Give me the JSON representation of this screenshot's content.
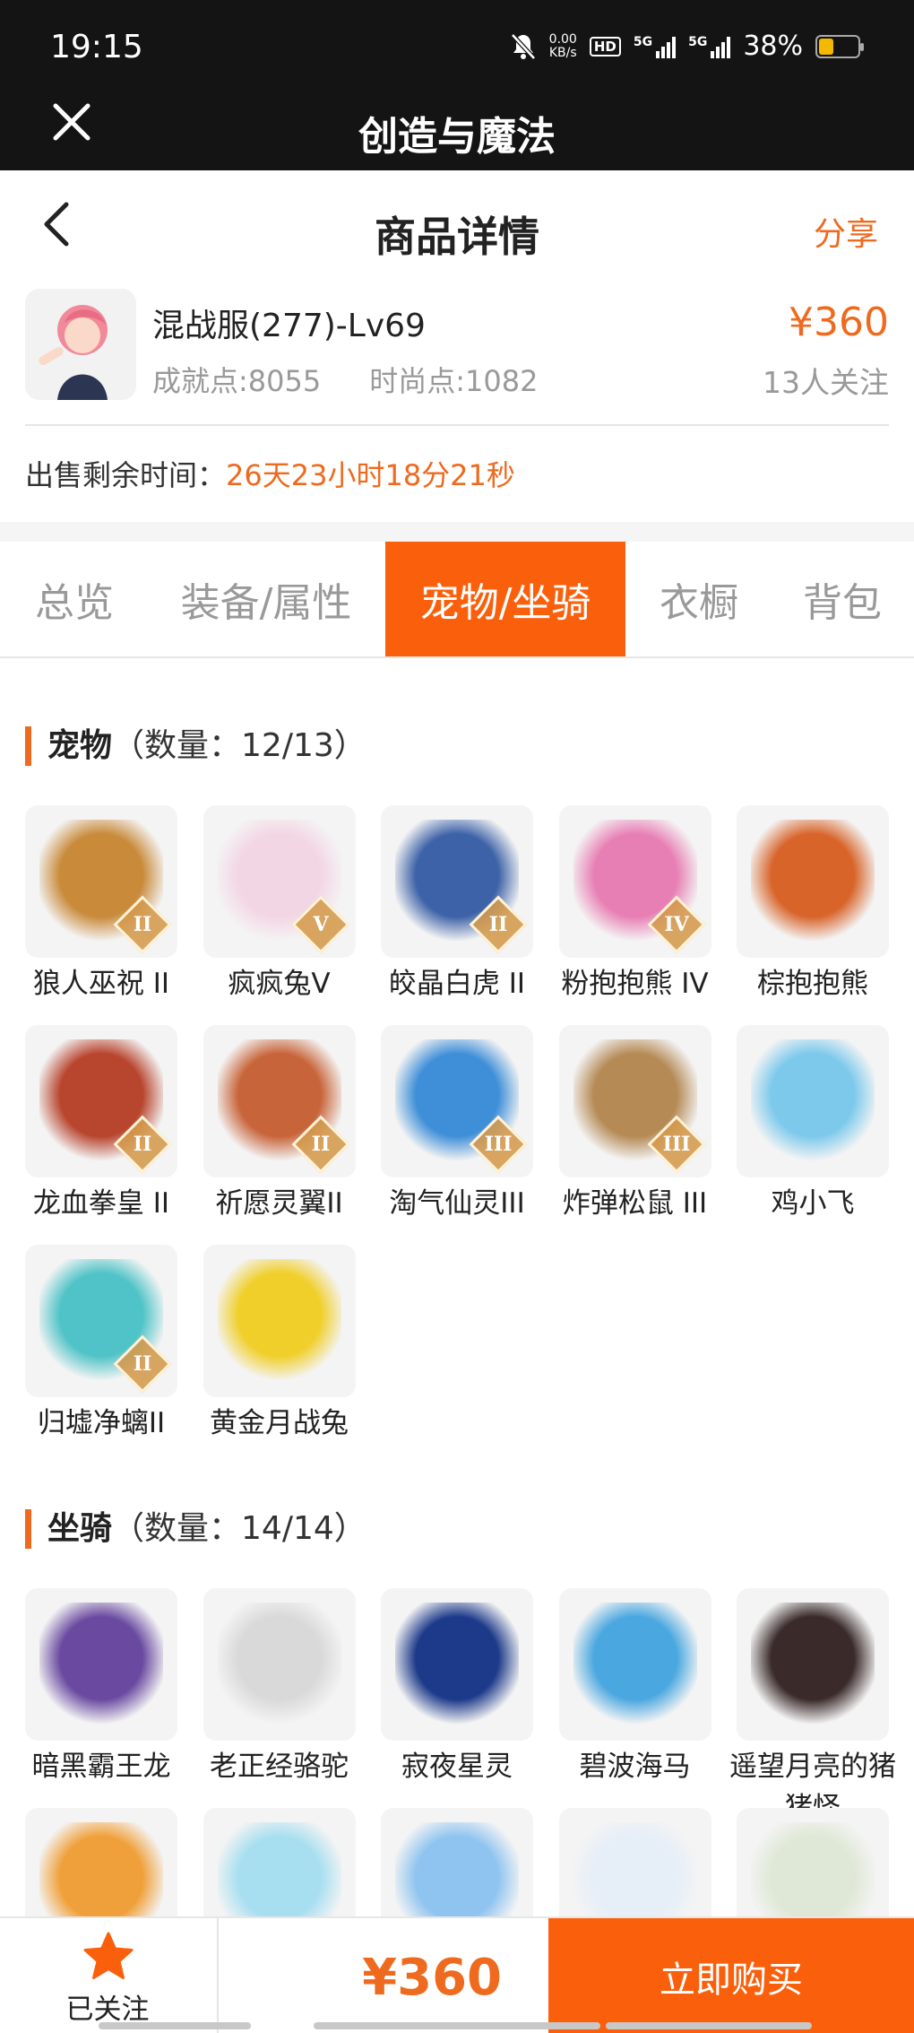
{
  "status_bar": {
    "time": "19:15",
    "net_speed_top": "0.00",
    "net_speed_unit": "KB/s",
    "hd_label": "HD",
    "sig1_label": "5G",
    "sig2_label": "5G",
    "battery_percent": "38%",
    "battery_level": 0.38
  },
  "app_bar": {
    "title": "创造与魔法",
    "close_icon": "close-icon"
  },
  "page": {
    "title": "商品详情",
    "share_label": "分享"
  },
  "product": {
    "name": "混战服(277)-Lv69",
    "achievement": "成就点:8055",
    "fashion": "时尚点:1082",
    "price": "¥360",
    "followers": "13人关注"
  },
  "remain": {
    "label": "出售剩余时间：",
    "time": "26天23小时18分21秒"
  },
  "tabs": [
    {
      "label": "总览"
    },
    {
      "label": "装备/属性"
    },
    {
      "label": "宠物/坐骑",
      "active": true
    },
    {
      "label": "衣橱"
    },
    {
      "label": "背包"
    }
  ],
  "pets": {
    "title": "宠物",
    "count": "（数量：12/13）",
    "items": [
      {
        "name": "狼人巫祝 II",
        "tier": "II",
        "color": "#c98a3a"
      },
      {
        "name": "疯疯兔V",
        "tier": "V",
        "color": "#f3d6e4"
      },
      {
        "name": "皎晶白虎 II",
        "tier": "II",
        "color": "#3d62a8"
      },
      {
        "name": "粉抱抱熊 IV",
        "tier": "IV",
        "color": "#e87fb4"
      },
      {
        "name": "棕抱抱熊",
        "tier": "",
        "color": "#d8642a"
      },
      {
        "name": "龙血拳皇 II",
        "tier": "II",
        "color": "#b8452e"
      },
      {
        "name": "祈愿灵翼II",
        "tier": "II",
        "color": "#c8643a"
      },
      {
        "name": "淘气仙灵III",
        "tier": "III",
        "color": "#3f8fd8"
      },
      {
        "name": "炸弹松鼠 III",
        "tier": "III",
        "color": "#b58a55"
      },
      {
        "name": "鸡小飞",
        "tier": "",
        "color": "#7cc9ec"
      },
      {
        "name": "归墟净螭II",
        "tier": "II",
        "color": "#4fc3c7"
      },
      {
        "name": "黄金月战兔",
        "tier": "",
        "color": "#f0cf2a"
      }
    ]
  },
  "mounts": {
    "title": "坐骑",
    "count": "（数量：14/14）",
    "items": [
      {
        "name": "暗黑霸王龙",
        "color": "#6a4aa0"
      },
      {
        "name": "老正经骆驼",
        "color": "#d9d9d9"
      },
      {
        "name": "寂夜星灵",
        "color": "#1d3a8a"
      },
      {
        "name": "碧波海马",
        "color": "#4aa7e0"
      },
      {
        "name": "遥望月亮的猪猪怪",
        "color": "#3a2a2a"
      },
      {
        "name": "",
        "color": "#f0a03a"
      },
      {
        "name": "",
        "color": "#a8dff0"
      },
      {
        "name": "",
        "color": "#8fc4f0"
      },
      {
        "name": "",
        "color": "#e6eef8"
      },
      {
        "name": "",
        "color": "#dfe8d6"
      }
    ]
  },
  "bottom_bar": {
    "follow_label": "已关注",
    "price": "¥360",
    "buy_label": "立即购买"
  },
  "colors": {
    "accent": "#fa600c",
    "accent_text": "#ee6a1e",
    "dark_bar": "#141414"
  }
}
